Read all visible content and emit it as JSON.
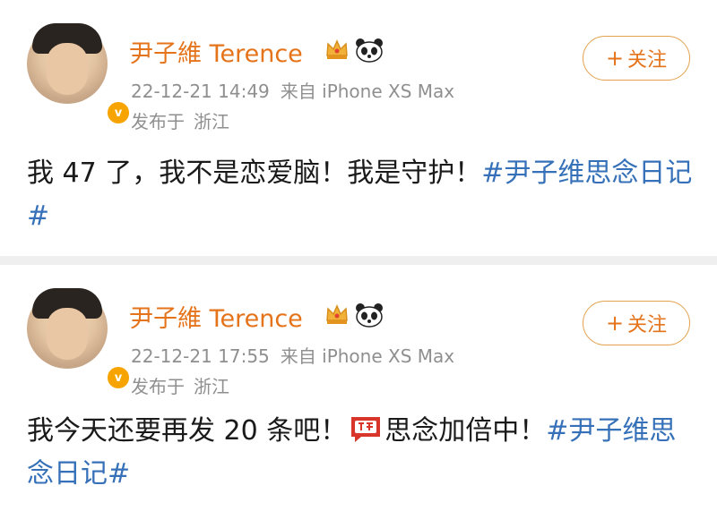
{
  "posts": [
    {
      "username": "尹子維 Terence",
      "timestamp": "22-12-21 14:49",
      "source": "来自 iPhone XS Max",
      "location_prefix": "发布于",
      "location": "浙江",
      "follow_label": "关注",
      "text_before": "我 47 了，我不是恋爱脑！我是守护！",
      "hashtag": "#尹子维思念日记#",
      "avatar_badge": "v"
    },
    {
      "username": "尹子維 Terence",
      "timestamp": "22-12-21 17:55",
      "source": "来自 iPhone XS Max",
      "location_prefix": "发布于",
      "location": "浙江",
      "follow_label": "关注",
      "text_before": "我今天还要再发 20 条吧！",
      "emoji": "ganbei-emoji-icon",
      "text_after": "思念加倍中！",
      "hashtag": "#尹子维思念日记#",
      "avatar_badge": "v"
    }
  ],
  "colors": {
    "username": "#e5731a",
    "meta": "#8f8f8f",
    "hashtag": "#3570b8",
    "follow_border": "#e2a24f",
    "badge": "#f7a400"
  }
}
